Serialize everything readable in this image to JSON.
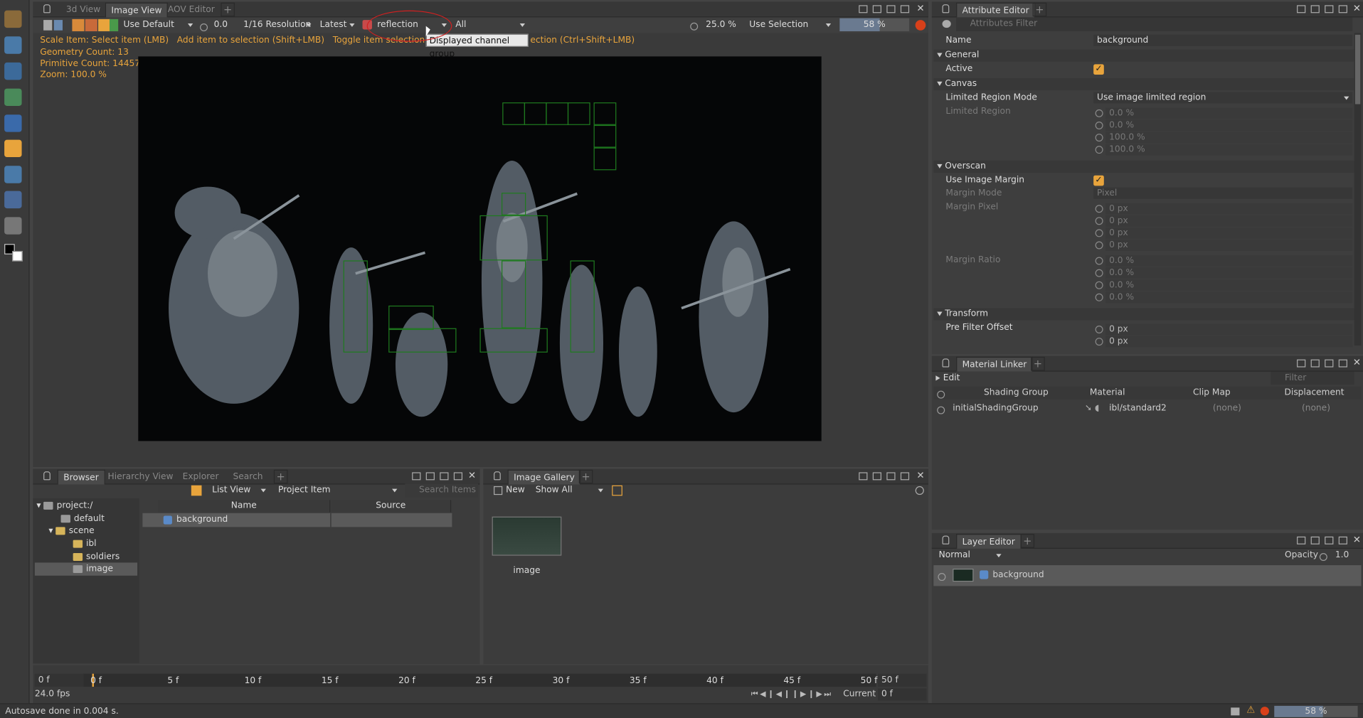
{
  "left_toolbar": {
    "icons": [
      "mari-logo-icon",
      "cube-icon",
      "brush-icon",
      "grid-image-icon",
      "box-icon",
      "fill-icon",
      "select-arrow-icon",
      "pen-icon",
      "eraser-icon"
    ]
  },
  "image_view": {
    "tabs": [
      "3d View",
      "Image View",
      "AOV Editor"
    ],
    "active_tab": "Image View",
    "toolbar": {
      "use_default": "Use Default",
      "gain": "0.0",
      "resolution": "1/16 Resolution",
      "latest": "Latest",
      "channel": "reflection",
      "all": "All",
      "zoom_pct": "25.0 %",
      "use_selection": "Use Selection",
      "progress": "58 %",
      "progress_value": 0.58
    },
    "tooltip": "Displayed channel group",
    "hint_line": {
      "a": "Scale Item: Select item (LMB)",
      "b": "Add item to selection (Shift+LMB)",
      "c": "Toggle item selection (Ctrl+LM",
      "d": "ection (Ctrl+Shift+LMB)"
    },
    "stats": {
      "geometry": "Geometry Count: 13",
      "primitive": "Primitive Count: 144573",
      "zoom": "Zoom: 100.0 %"
    }
  },
  "browser": {
    "tabs": [
      "Browser",
      "Hierarchy View",
      "Explorer",
      "Search"
    ],
    "active_tab": "Browser",
    "view_mode": "List View",
    "item_type": "Project Item",
    "search_placeholder": "Search Items",
    "tree": [
      {
        "label": "project:/",
        "level": 0
      },
      {
        "label": "default",
        "level": 1
      },
      {
        "label": "scene",
        "level": 1
      },
      {
        "label": "ibl",
        "level": 2
      },
      {
        "label": "soldiers",
        "level": 2
      },
      {
        "label": "image",
        "level": 1
      }
    ],
    "columns": [
      "Name",
      "Source"
    ],
    "rows": [
      {
        "name": "background",
        "source": ""
      }
    ]
  },
  "gallery": {
    "tab": "Image Gallery",
    "new_label": "New",
    "filter": "Show All",
    "thumb_label": "image"
  },
  "timeline": {
    "start": "0 f",
    "ticks": [
      "0 f",
      "5 f",
      "10 f",
      "15 f",
      "20 f",
      "25 f",
      "30 f",
      "35 f",
      "40 f",
      "45 f",
      "50 f"
    ],
    "end": "50 f",
    "fps": "24.0 fps",
    "current_label": "Current",
    "current_value": "0 f"
  },
  "attribute_editor": {
    "tab": "Attribute Editor",
    "filter_placeholder": "Attributes Filter",
    "name_label": "Name",
    "name_value": "background",
    "sections": {
      "general": "General",
      "canvas": "Canvas",
      "overscan": "Overscan",
      "transform": "Transform"
    },
    "active_label": "Active",
    "limited_region_mode_label": "Limited Region Mode",
    "limited_region_mode_value": "Use image limited region",
    "limited_region_label": "Limited Region",
    "limited_region_values": [
      "0.0 %",
      "0.0 %",
      "100.0 %",
      "100.0 %"
    ],
    "use_image_margin_label": "Use Image Margin",
    "margin_mode_label": "Margin Mode",
    "margin_mode_value": "Pixel",
    "margin_pixel_label": "Margin Pixel",
    "margin_pixel_values": [
      "0 px",
      "0 px",
      "0 px",
      "0 px"
    ],
    "margin_ratio_label": "Margin Ratio",
    "margin_ratio_values": [
      "0.0 %",
      "0.0 %",
      "0.0 %",
      "0.0 %"
    ],
    "pre_filter_label": "Pre Filter Offset",
    "pre_filter_values": [
      "0 px",
      "0 px"
    ]
  },
  "material_linker": {
    "tab": "Material Linker",
    "edit_label": "Edit",
    "filter_placeholder": "Filter",
    "columns": [
      "Shading Group",
      "Material",
      "Clip Map",
      "Displacement"
    ],
    "row": {
      "group": "initialShadingGroup",
      "material": "ibl/standard2",
      "clip": "(none)",
      "disp": "(none)"
    }
  },
  "layer_editor": {
    "tab": "Layer Editor",
    "blend": "Normal",
    "opacity_label": "Opacity",
    "opacity_value": "1.0",
    "layer": "background"
  },
  "status_bar": {
    "message": "Autosave done in 0.004 s.",
    "progress": "58 %",
    "progress_value": 0.58
  },
  "colors": {
    "accent": "#e8a43c",
    "grid": "#1f7a1f"
  }
}
